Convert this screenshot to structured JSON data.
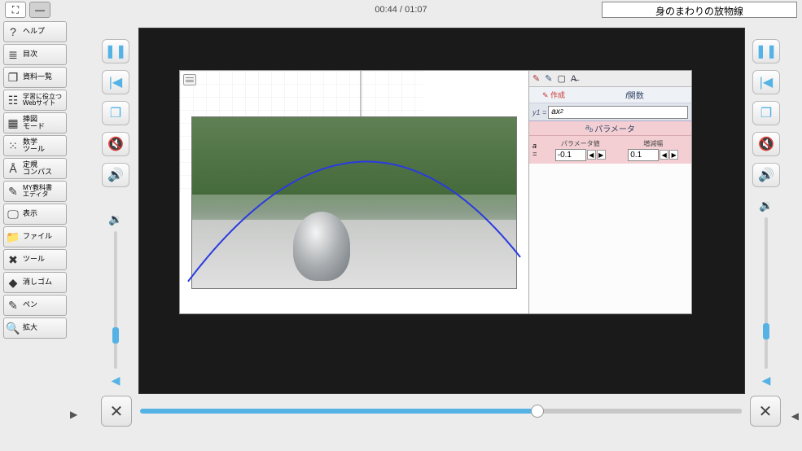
{
  "header": {
    "timecode": "00:44 / 01:07",
    "title": "身のまわりの放物線"
  },
  "sidebar": {
    "items": [
      {
        "icon": "?",
        "label": "ヘルプ"
      },
      {
        "icon": "≣",
        "label": "目次"
      },
      {
        "icon": "❐",
        "label": "資料一覧"
      },
      {
        "icon": "☷",
        "label": "学習に役立つ\nWebサイト"
      },
      {
        "icon": "▦",
        "label": "挿図\nモード"
      },
      {
        "icon": "⁙",
        "label": "数学\nツール"
      },
      {
        "icon": "Å",
        "label": "定規\nコンパス"
      },
      {
        "icon": "✎",
        "label": "MY教科書\nエディタ"
      },
      {
        "icon": "🖵",
        "label": "表示"
      },
      {
        "icon": "📁",
        "label": "ファイル"
      },
      {
        "icon": "✖",
        "label": "ツール"
      },
      {
        "icon": "◆",
        "label": "消しゴム"
      },
      {
        "icon": "✎",
        "label": "ペン"
      },
      {
        "icon": "🔍",
        "label": "拡大"
      }
    ]
  },
  "vcontrols": {
    "pause": "❚❚",
    "prev": "|◀",
    "window": "❐",
    "nospeaker": "🔇",
    "speaker": "🔊",
    "mutevol": "🔉",
    "refresh": "⟲",
    "close": "✕"
  },
  "funcpanel": {
    "row1_left": "作成",
    "row1_right": "関数",
    "eq_prefix": "y1 =",
    "eq_body": "ax",
    "eq_sup": "2",
    "param_header": "パラメータ",
    "param_ab": "a",
    "param_a_label": "a =",
    "col1_h": "パラメータ値",
    "col2_h": "増減幅",
    "val1": "-0.1",
    "val2": "0.1"
  },
  "timeline": {
    "progress_pct": 66
  }
}
